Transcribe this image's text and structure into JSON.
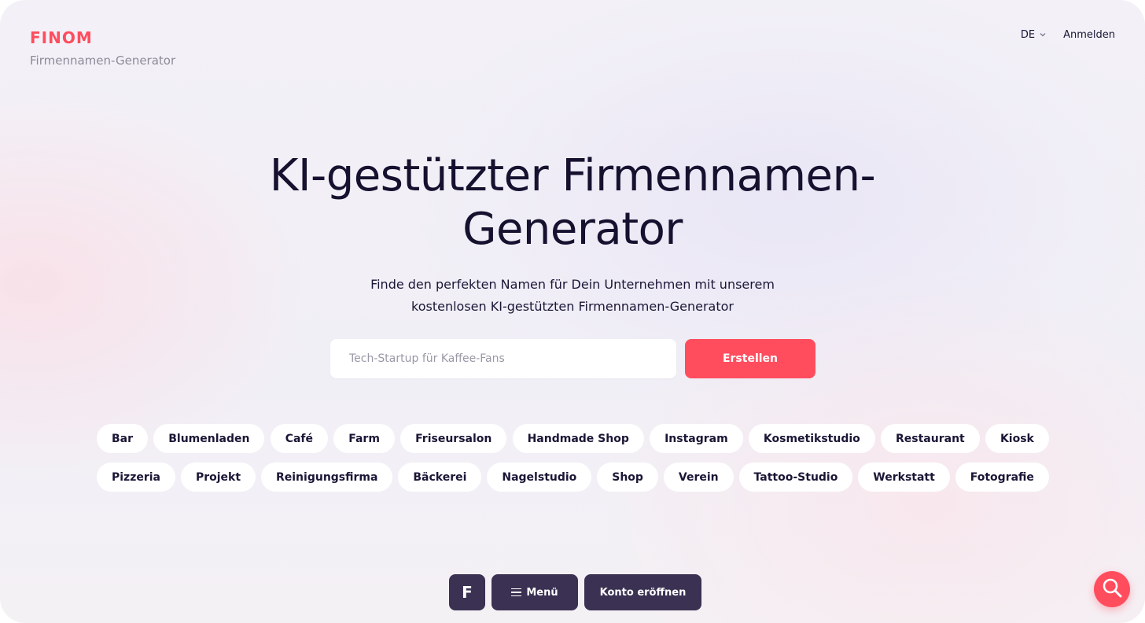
{
  "header": {
    "logo": "FINOM",
    "subtitle": "Firmennamen-Generator",
    "language": "DE",
    "login_label": "Anmelden"
  },
  "hero": {
    "title_line1": "KI-gestützter Firmennamen-",
    "title_line2": "Generator",
    "lead_line1": "Finde den perfekten Namen für Dein Unternehmen mit unserem",
    "lead_line2": "kostenlosen KI-gestützten Firmennamen-Generator"
  },
  "search": {
    "value": "",
    "placeholder": "Tech-Startup für Kaffee-Fans",
    "button_label": "Erstellen"
  },
  "categories": {
    "row1": [
      "Bar",
      "Blumenladen",
      "Café",
      "Farm",
      "Friseursalon",
      "Handmade Shop",
      "Instagram",
      "Kosmetikstudio",
      "Restaurant",
      "Kiosk"
    ],
    "row2": [
      "Pizzeria",
      "Projekt",
      "Reinigungsfirma",
      "Bäckerei",
      "Nagelstudio",
      "Shop",
      "Verein",
      "Tattoo-Studio",
      "Werkstatt",
      "Fotografie"
    ]
  },
  "bottom_bar": {
    "logo_glyph": "F",
    "menu_label": "Menü",
    "account_label": "Konto eröffnen"
  },
  "icons": {
    "search_fab": "search-icon",
    "menu": "hamburger-icon",
    "language": "chevron-down-icon"
  },
  "colors": {
    "accent": "#ff4d5e",
    "dark_button": "#3b3152",
    "text": "#15112f"
  }
}
